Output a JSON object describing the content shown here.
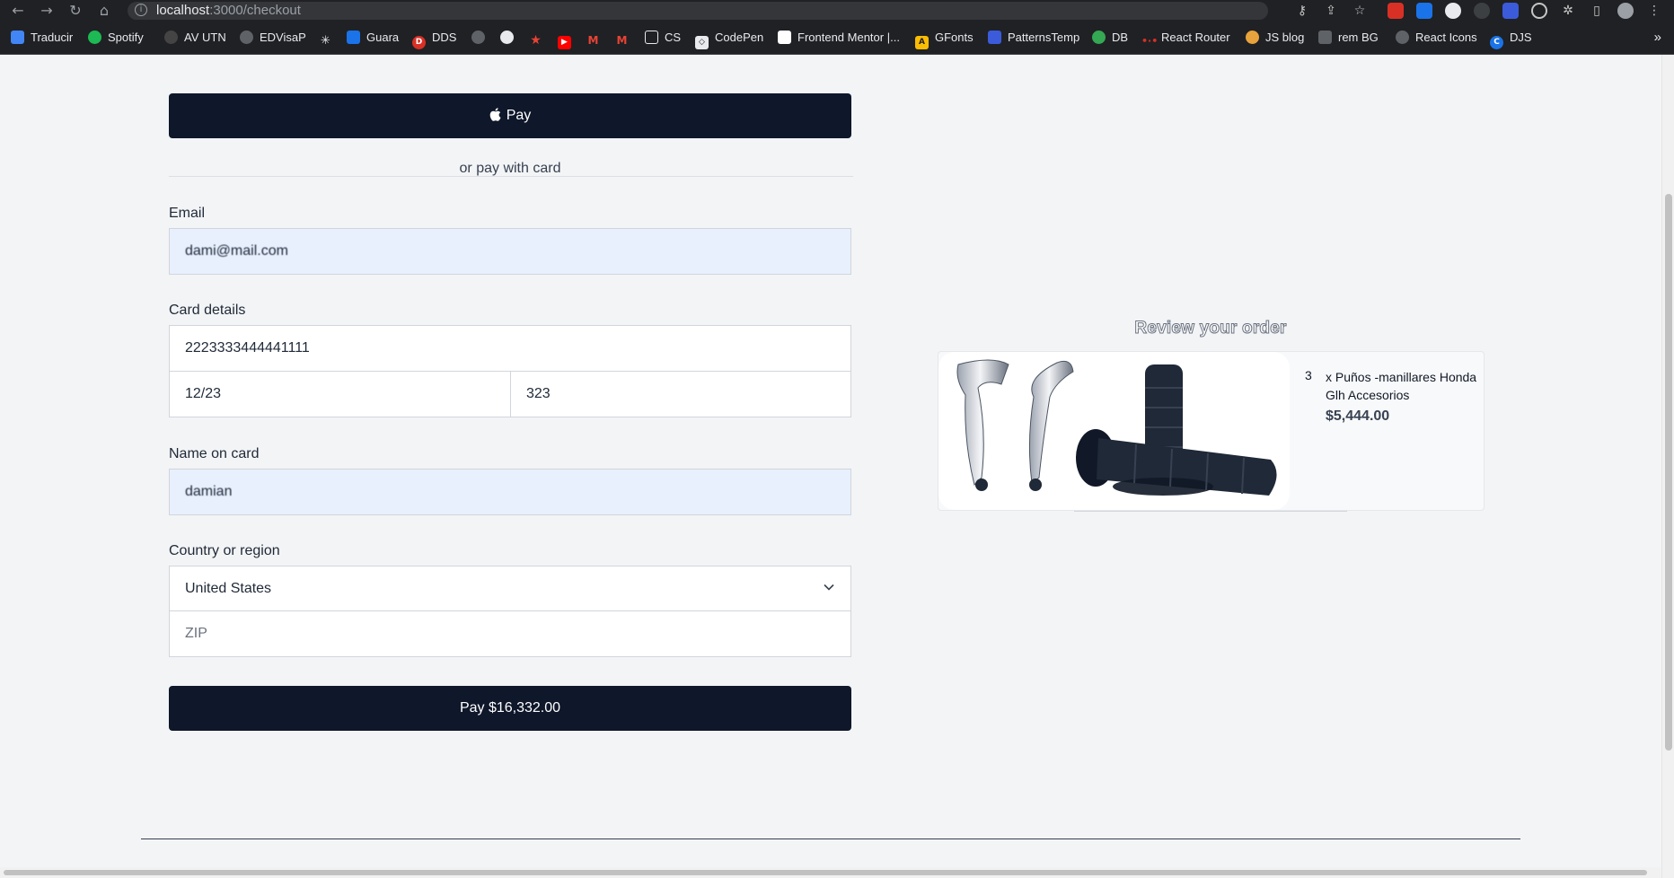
{
  "browser": {
    "url_host": "localhost",
    "url_path": ":3000/checkout",
    "bookmarks": [
      {
        "label": "Traducir",
        "color": "#4285f4"
      },
      {
        "label": "Spotify",
        "color": "#1db954"
      },
      {
        "label": "AV UTN",
        "color": "#444444"
      },
      {
        "label": "EDVisaP",
        "color": "#5f6368"
      },
      {
        "label": "",
        "color": "#202124"
      },
      {
        "label": "Guara",
        "color": "#1a73e8"
      },
      {
        "label": "DDS",
        "color": "#d93025"
      },
      {
        "label": "",
        "color": "#5f6368"
      },
      {
        "label": "",
        "color": "#202124"
      },
      {
        "label": "",
        "color": "#ea4335"
      },
      {
        "label": "",
        "color": "#ff0000"
      },
      {
        "label": "",
        "color": "#ea4335"
      },
      {
        "label": "",
        "color": "#ea4335"
      },
      {
        "label": "CS",
        "color": "#202124"
      },
      {
        "label": "CodePen",
        "color": "#202124"
      },
      {
        "label": "Frontend Mentor |...",
        "color": "#ffffff"
      },
      {
        "label": "GFonts",
        "color": "#fbbc04"
      },
      {
        "label": "PatternsTemp",
        "color": "#3b5bdb"
      },
      {
        "label": "DB",
        "color": "#34a853"
      },
      {
        "label": "React Router",
        "color": "#d93025"
      },
      {
        "label": "JS blog",
        "color": "#e8a33c"
      },
      {
        "label": "rem BG",
        "color": "#5f6368"
      },
      {
        "label": "React Icons",
        "color": "#5f6368"
      },
      {
        "label": "DJS",
        "color": "#1a73e8"
      }
    ]
  },
  "checkout": {
    "apple_pay_label": "Pay",
    "divider_text": "or pay with card",
    "email_label": "Email",
    "email_value": "dami@mail.com",
    "card_details_label": "Card details",
    "card_number": "2223333444441111",
    "card_expiry": "12/23",
    "card_cvc": "323",
    "name_label": "Name on card",
    "name_value": "damian",
    "country_label": "Country or region",
    "country_value": "United States",
    "zip_placeholder": "ZIP",
    "pay_button_label": "Pay $16,332.00"
  },
  "review": {
    "title": "Review your order",
    "items": [
      {
        "qty": "3",
        "name": "x Puños -manillares Honda Glh Accesorios",
        "price": "$5,444.00"
      }
    ]
  },
  "colors": {
    "primary_dark": "#0f172a",
    "autofill_bg": "#e8f0fe",
    "page_bg": "#f3f4f6"
  }
}
